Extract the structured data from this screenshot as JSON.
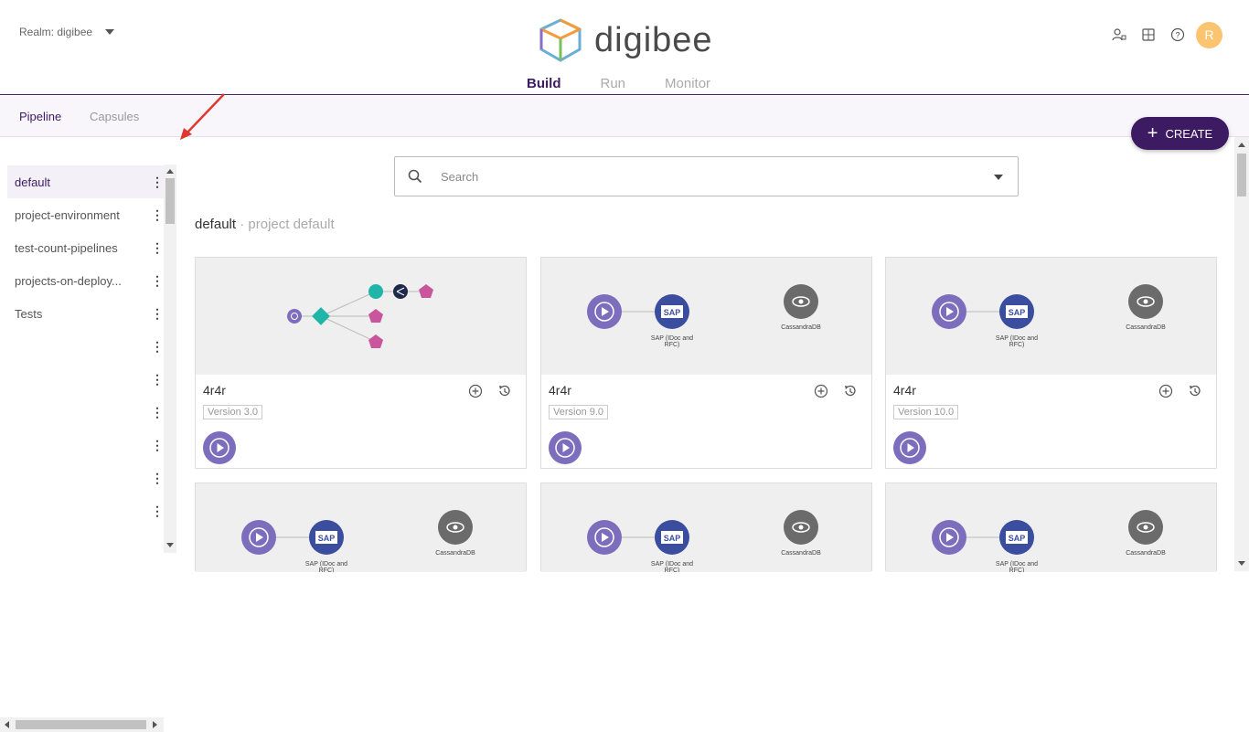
{
  "header": {
    "realm_label": "Realm: digibee",
    "logo_text": "digibee",
    "nav": [
      "Build",
      "Run",
      "Monitor"
    ],
    "avatar_initial": "R",
    "icons": [
      "user-lock-icon",
      "calculator-icon",
      "help-icon"
    ]
  },
  "subnav": {
    "tabs": [
      "Pipeline",
      "Capsules"
    ]
  },
  "create_button": {
    "label": "CREATE"
  },
  "sidebar": {
    "projects": [
      "default",
      "project-environment",
      "test-count-pipelines",
      "projects-on-deploy...",
      "Tests",
      "",
      "",
      "",
      "",
      "",
      "",
      ""
    ]
  },
  "search": {
    "placeholder": "Search"
  },
  "section": {
    "title": "default",
    "separator": " · ",
    "subtitle": "project default"
  },
  "cards": [
    {
      "name": "4r4r",
      "version": "Version 3.0",
      "diagram": "flow"
    },
    {
      "name": "4r4r",
      "version": "Version 9.0",
      "diagram": "sap"
    },
    {
      "name": "4r4r",
      "version": "Version 10.0",
      "diagram": "sap"
    },
    {
      "name": "",
      "version": "",
      "diagram": "sap"
    },
    {
      "name": "",
      "version": "",
      "diagram": "sap"
    },
    {
      "name": "",
      "version": "",
      "diagram": "sap"
    }
  ],
  "diagram_labels": {
    "sap_line1": "SAP (IDoc and",
    "sap_line2": "RFC)",
    "sap_logo": "SAP",
    "cassandra": "CassandraDB"
  },
  "colors": {
    "brand": "#3d1b63",
    "trigger": "#7c6dbd",
    "sap": "#3a4d9e",
    "cassandra": "#6b6b6b",
    "teal": "#1fb5a8",
    "pink": "#c9559c",
    "avatar": "#fbc470"
  }
}
